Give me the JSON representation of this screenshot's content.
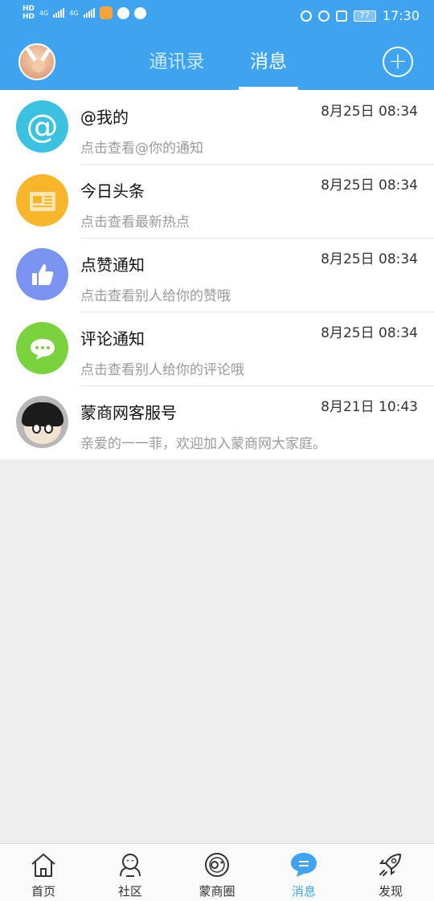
{
  "status_bar": {
    "sim1": "HD",
    "sim2": "HD",
    "net1": "4G",
    "net2": "4G",
    "battery": "77",
    "time": "17:30"
  },
  "header": {
    "tabs": [
      "通讯录",
      "消息"
    ],
    "active_tab": "消息",
    "add_label": "+"
  },
  "colors": {
    "primary": "#3ea4ef",
    "mention": "#3cc2e1",
    "headline": "#f7b52a",
    "like": "#7b93f0",
    "comment": "#7ad33d"
  },
  "messages": [
    {
      "title": "@我的",
      "subtitle": "点击查看@你的通知",
      "time": "8月25日 08:34",
      "icon": "at-icon"
    },
    {
      "title": "今日头条",
      "subtitle": "点击查看最新热点",
      "time": "8月25日 08:34",
      "icon": "newspaper-icon"
    },
    {
      "title": "点赞通知",
      "subtitle": "点击查看别人给你的赞哦",
      "time": "8月25日 08:34",
      "icon": "thumbs-up-icon"
    },
    {
      "title": "评论通知",
      "subtitle": "点击查看别人给你的评论哦",
      "time": "8月25日 08:34",
      "icon": "comment-bubble-icon"
    },
    {
      "title": "蒙商网客服号",
      "subtitle": "亲爱的一一菲，欢迎加入蒙商网大家庭。",
      "time": "8月21日 10:43",
      "icon": "service-avatar"
    }
  ],
  "tabbar": {
    "items": [
      {
        "label": "首页",
        "icon": "home-icon"
      },
      {
        "label": "社区",
        "icon": "community-icon"
      },
      {
        "label": "蒙商圈",
        "icon": "planet-icon"
      },
      {
        "label": "消息",
        "icon": "message-icon"
      },
      {
        "label": "发现",
        "icon": "rocket-icon"
      }
    ],
    "active": "消息"
  }
}
